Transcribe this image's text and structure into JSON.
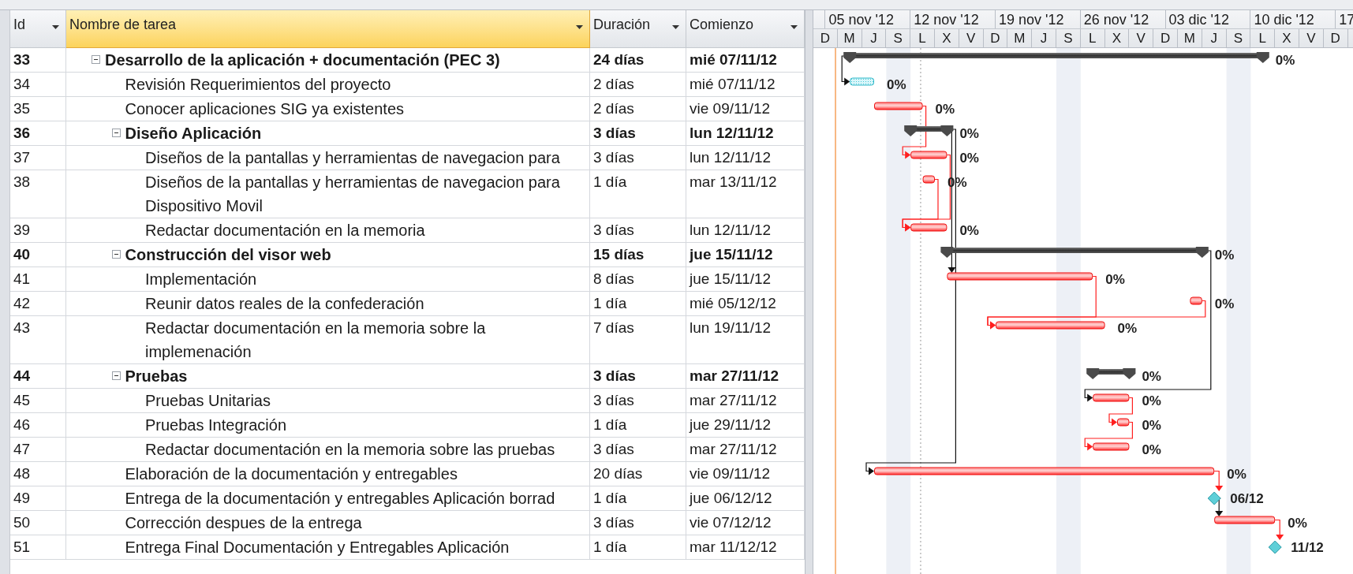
{
  "columns": [
    {
      "label": "Id",
      "selected": false
    },
    {
      "label": "Nombre de tarea",
      "selected": true
    },
    {
      "label": "Duración",
      "selected": false
    },
    {
      "label": "Comienzo",
      "selected": false
    }
  ],
  "timescale": {
    "weeks": [
      "05 nov '12",
      "12 nov '12",
      "19 nov '12",
      "26 nov '12",
      "03 dic '12",
      "10 dic '12",
      "17"
    ],
    "days": [
      "D",
      "M",
      "J",
      "S",
      "L",
      "X",
      "V",
      "D",
      "M",
      "J",
      "S",
      "L",
      "X",
      "V",
      "D",
      "M",
      "J",
      "S",
      "L",
      "X",
      "V",
      "D"
    ]
  },
  "tasks": [
    {
      "id": "33",
      "name": "Desarrollo de la aplicación + documentación (PEC 3)",
      "duration": "24 días",
      "start": "mié 07/11/12",
      "summary": true,
      "expanded": true,
      "bar": {
        "kind": "summary",
        "label": "0%"
      },
      "children": [
        {
          "id": "34",
          "name": "Revisión Requerimientos del proyecto",
          "duration": "2 días",
          "start": "mié 07/11/12",
          "summary": false,
          "bar": {
            "kind": "task",
            "critical": false,
            "label": "0%"
          }
        },
        {
          "id": "35",
          "name": "Conocer aplicaciones SIG ya existentes",
          "duration": "2 días",
          "start": "vie 09/11/12",
          "summary": false,
          "bar": {
            "kind": "task",
            "critical": true,
            "label": "0%"
          }
        },
        {
          "id": "36",
          "name": "Diseño Aplicación",
          "duration": "3 días",
          "start": "lun 12/11/12",
          "summary": true,
          "expanded": true,
          "bar": {
            "kind": "summary",
            "label": "0%"
          },
          "children": [
            {
              "id": "37",
              "name": "Diseños de la pantallas y herramientas de navegacion para",
              "duration": "3 días",
              "start": "lun 12/11/12",
              "summary": false,
              "bar": {
                "kind": "task",
                "critical": true,
                "label": "0%"
              }
            },
            {
              "id": "38",
              "name": "Diseños de la pantallas y herramientas de navegacion para Dispositivo Movil",
              "duration": "1 día",
              "start": "mar 13/11/12",
              "summary": false,
              "bar": {
                "kind": "task",
                "critical": true,
                "label": "0%"
              }
            },
            {
              "id": "39",
              "name": "Redactar documentación en la memoria",
              "duration": "3 días",
              "start": "lun 12/11/12",
              "summary": false,
              "bar": {
                "kind": "task",
                "critical": true,
                "label": "0%"
              }
            }
          ]
        },
        {
          "id": "40",
          "name": "Construcción del visor web",
          "duration": "15 días",
          "start": "jue 15/11/12",
          "summary": true,
          "expanded": true,
          "bar": {
            "kind": "summary",
            "label": "0%"
          },
          "children": [
            {
              "id": "41",
              "name": "Implementación",
              "duration": "8 días",
              "start": "jue 15/11/12",
              "summary": false,
              "bar": {
                "kind": "task",
                "critical": true,
                "label": "0%"
              }
            },
            {
              "id": "42",
              "name": "Reunir datos reales de la confederación",
              "duration": "1 día",
              "start": "mié 05/12/12",
              "summary": false,
              "bar": {
                "kind": "task",
                "critical": true,
                "label": "0%"
              }
            },
            {
              "id": "43",
              "name": "Redactar documentación en la memoria sobre la implemenación",
              "duration": "7 días",
              "start": "lun 19/11/12",
              "summary": false,
              "bar": {
                "kind": "task",
                "critical": true,
                "label": "0%"
              }
            }
          ]
        },
        {
          "id": "44",
          "name": "Pruebas",
          "duration": "3 días",
          "start": "mar 27/11/12",
          "summary": true,
          "expanded": true,
          "bar": {
            "kind": "summary",
            "label": "0%"
          },
          "children": [
            {
              "id": "45",
              "name": "Pruebas Unitarias",
              "duration": "3 días",
              "start": "mar 27/11/12",
              "summary": false,
              "bar": {
                "kind": "task",
                "critical": true,
                "label": "0%"
              }
            },
            {
              "id": "46",
              "name": "Pruebas Integración",
              "duration": "1 día",
              "start": "jue 29/11/12",
              "summary": false,
              "bar": {
                "kind": "task",
                "critical": true,
                "label": "0%"
              }
            },
            {
              "id": "47",
              "name": "Redactar documentación en la memoria sobre las pruebas",
              "duration": "3 días",
              "start": "mar 27/11/12",
              "summary": false,
              "bar": {
                "kind": "task",
                "critical": true,
                "label": "0%"
              }
            }
          ]
        },
        {
          "id": "48",
          "name": "Elaboración de la documentación y entregables",
          "duration": "20 días",
          "start": "vie 09/11/12",
          "summary": false,
          "bar": {
            "kind": "task",
            "critical": true,
            "label": "0%"
          }
        },
        {
          "id": "49",
          "name": "Entrega de la documentación y entregables Aplicación borrad",
          "duration": "1 día",
          "start": "jue 06/12/12",
          "summary": false,
          "bar": {
            "kind": "milestone",
            "label": "06/12"
          }
        },
        {
          "id": "50",
          "name": "Corrección despues de la entrega",
          "duration": "3 días",
          "start": "vie 07/12/12",
          "summary": false,
          "bar": {
            "kind": "task",
            "critical": true,
            "label": "0%"
          }
        },
        {
          "id": "51",
          "name": "Entrega Final Documentación y Entregables Aplicación",
          "duration": "1 día",
          "start": "mar 11/12/12",
          "summary": false,
          "bar": {
            "kind": "milestone",
            "label": "11/12"
          }
        }
      ]
    }
  ]
}
